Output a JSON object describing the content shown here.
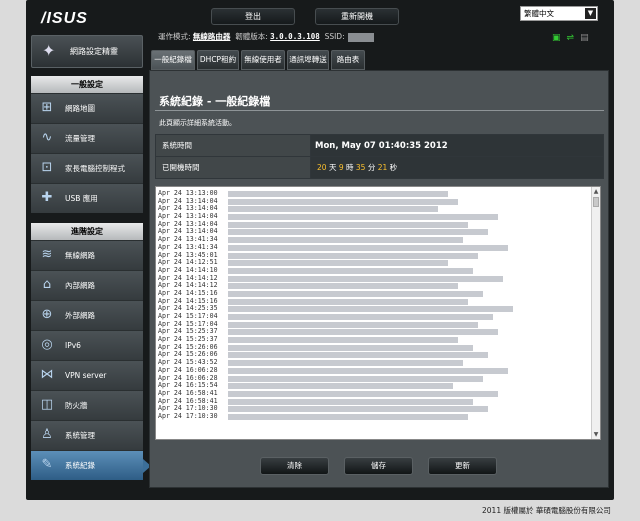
{
  "header": {
    "logo": "/ISUS",
    "logout_label": "登出",
    "reboot_label": "重新開機",
    "language": "繁體中文"
  },
  "infobar": {
    "mode_label": "運作模式:",
    "mode_value": "無線路由器",
    "firmware_label": "韌體版本:",
    "firmware_value": "3.0.0.3.108",
    "ssid_label": "SSID:"
  },
  "status_icons": [
    "network-icon",
    "usb-icon",
    "printer-icon"
  ],
  "quick_setup": {
    "label": "網路設定精靈"
  },
  "general_menu": {
    "header": "一般設定",
    "items": [
      {
        "label": "網路地圖",
        "icon": "network-map-icon"
      },
      {
        "label": "流量管理",
        "icon": "traffic-icon"
      },
      {
        "label": "家長電腦控制程式",
        "icon": "parental-control-icon"
      },
      {
        "label": "USB 應用",
        "icon": "usb-app-icon"
      }
    ]
  },
  "advanced_menu": {
    "header": "進階設定",
    "items": [
      {
        "label": "無線網路",
        "icon": "wireless-icon"
      },
      {
        "label": "內部網路",
        "icon": "lan-icon"
      },
      {
        "label": "外部網路",
        "icon": "wan-icon"
      },
      {
        "label": "IPv6",
        "icon": "ipv6-icon"
      },
      {
        "label": "VPN server",
        "icon": "vpn-icon"
      },
      {
        "label": "防火牆",
        "icon": "firewall-icon"
      },
      {
        "label": "系統管理",
        "icon": "admin-icon"
      },
      {
        "label": "系統紀錄",
        "icon": "log-icon"
      }
    ]
  },
  "tabs": [
    "一般紀錄檔",
    "DHCP租約",
    "無線使用者",
    "通訊埠轉送",
    "路由表"
  ],
  "panel": {
    "title": "系統紀錄 - 一般紀錄檔",
    "description": "此頁顯示詳細系統活動。",
    "system_time_label": "系統時間",
    "system_time_value": "Mon, May 07  01:40:35  2012",
    "uptime_label": "已開機時間",
    "uptime": {
      "days": "20",
      "days_unit": "天",
      "hours": "9",
      "hours_unit": "時",
      "minutes": "35",
      "minutes_unit": "分",
      "seconds": "21",
      "seconds_unit": "秒"
    }
  },
  "log_lines": [
    "Apr 24 13:13:00",
    "Apr 24 13:14:04",
    "Apr 24 13:14:04",
    "Apr 24 13:14:04",
    "Apr 24 13:14:04",
    "Apr 24 13:14:04",
    "Apr 24 13:41:34",
    "Apr 24 13:41:34",
    "Apr 24 13:45:01",
    "Apr 24 14:12:51",
    "Apr 24 14:14:10",
    "Apr 24 14:14:12",
    "Apr 24 14:14:12",
    "Apr 24 14:15:16",
    "Apr 24 14:15:16",
    "Apr 24 14:25:35",
    "Apr 24 15:17:04",
    "Apr 24 15:17:04",
    "Apr 24 15:25:37",
    "Apr 24 15:25:37",
    "Apr 24 15:26:06",
    "Apr 24 15:26:06",
    "Apr 24 15:43:52",
    "Apr 24 16:06:28",
    "Apr 24 16:06:28",
    "Apr 24 16:15:54",
    "Apr 24 16:58:41",
    "Apr 24 16:58:41",
    "Apr 24 17:10:30",
    "Apr 24 17:10:30"
  ],
  "buttons": {
    "clear": "清除",
    "save": "儲存",
    "refresh": "更新"
  },
  "footer": "2011 版權屬於 華碩電腦股份有限公司"
}
